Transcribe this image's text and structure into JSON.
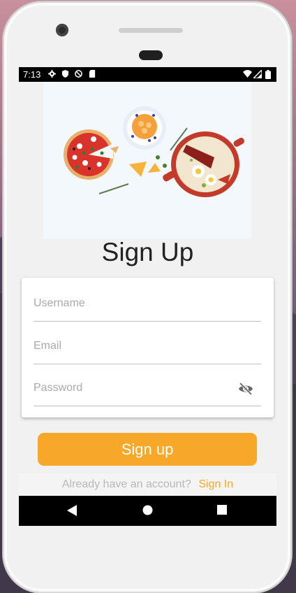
{
  "status_bar": {
    "time": "7:13",
    "left_icons": [
      "gear-icon",
      "shield-icon",
      "no-sync-icon",
      "sd-card-icon"
    ],
    "right_icons": [
      "wifi-icon",
      "signal-icon",
      "battery-icon"
    ]
  },
  "hero": {
    "illustration": "food-illustration"
  },
  "page": {
    "title": "Sign Up"
  },
  "form": {
    "username": {
      "placeholder": "Username",
      "value": ""
    },
    "email": {
      "placeholder": "Email",
      "value": ""
    },
    "password": {
      "placeholder": "Password",
      "value": "",
      "toggle_icon": "eye-off-icon"
    }
  },
  "actions": {
    "signup_label": "Sign up"
  },
  "footer": {
    "question": "Already have an account?",
    "signin_label": "Sign In"
  },
  "nav": {
    "icons": [
      "back-icon",
      "home-icon",
      "recents-icon"
    ]
  },
  "colors": {
    "accent": "#f7a829",
    "hero_bg": "#f3f8fd"
  }
}
